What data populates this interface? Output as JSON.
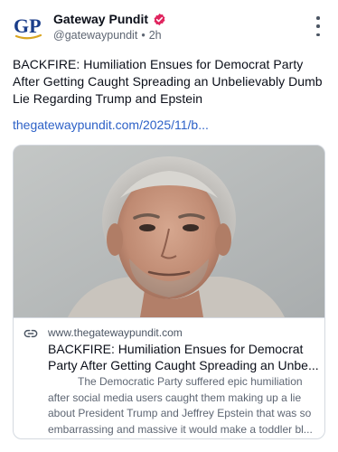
{
  "author": {
    "avatar_text": "GP",
    "display_name": "Gateway Pundit",
    "handle": "@gatewaypundit",
    "separator": "•",
    "time": "2h"
  },
  "post": {
    "text": "BACKFIRE: Humiliation Ensues for Democrat Party After Getting Caught Spreading an Unbelievably Dumb Lie Regarding Trump and Epstein",
    "link_text": "thegatewaypundit.com/2025/11/b..."
  },
  "card": {
    "domain": "www.thegatewaypundit.com",
    "title_lines": [
      "BACKFIRE: Humiliation Ensues for Democrat",
      "Party After Getting Caught Spreading an Unbe..."
    ],
    "description_lines": [
      "The Democratic Party suffered epic humiliation",
      "after social media users caught them making up a lie",
      "about President Trump and Jeffrey Epstein that was so",
      "embarrassing and massive it would make a toddler bl..."
    ]
  },
  "icons": {
    "verified": "verified-badge-icon",
    "more": "more-vertical-icon",
    "link": "link-icon"
  },
  "colors": {
    "verified_badge": "#e0245e",
    "link": "#2d61c7",
    "brand_blue": "#1b3e8a",
    "brand_gold": "#d9a520"
  }
}
